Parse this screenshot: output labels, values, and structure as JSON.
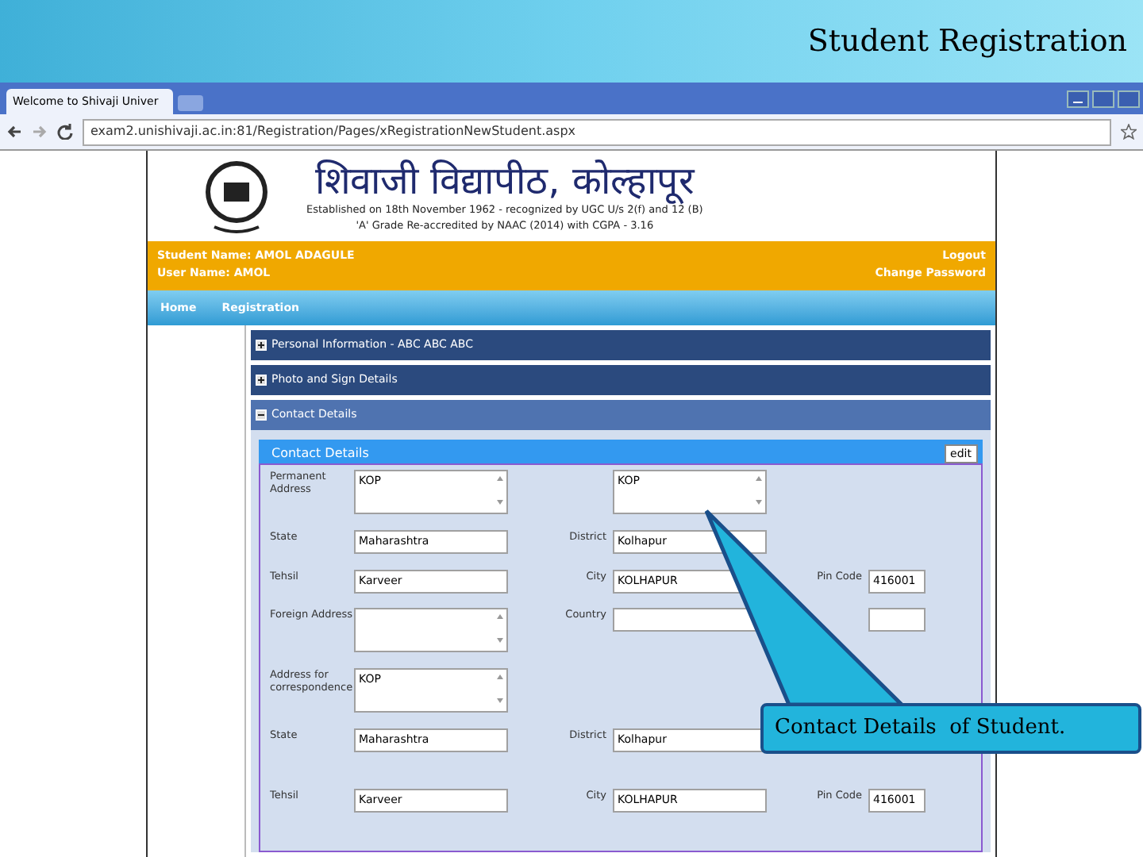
{
  "slide": {
    "title": "Student Registration"
  },
  "browser": {
    "tabs": [
      {
        "label": "Welcome to Shivaji Univer",
        "selected": true
      }
    ],
    "url": "exam2.unishivaji.ac.in:81/Registration/Pages/xRegistrationNewStudent.aspx"
  },
  "site_header": {
    "title": "शिवाजी विद्यापीठ, कोल्हापूर",
    "subtitle": "Established on 18th November 1962 - recognized by UGC U/s 2(f) and 12 (B)",
    "accreditation": "'A' Grade Re-accredited by NAAC (2014) with CGPA - 3.16"
  },
  "user_bar": {
    "student_name": "Student Name: AMOL ADAGULE",
    "user_name": "User Name: AMOL",
    "links": [
      "Logout",
      "Change Password"
    ]
  },
  "nav": [
    "Home",
    "Registration"
  ],
  "sections": [
    {
      "title": "Personal Information - ABC ABC ABC",
      "expanded": false
    },
    {
      "title": "Photo and Sign Details",
      "expanded": false
    },
    {
      "title": "Contact Details",
      "expanded": true
    }
  ],
  "contact_panel": {
    "title": "Contact Details",
    "edit_button": "edit",
    "rows": [
      {
        "fields": [
          {
            "label": "Permanent Address",
            "kind": "textarea",
            "value": "KOP"
          },
          {
            "kind": "textarea",
            "value": "KOP"
          }
        ]
      },
      {
        "fields": [
          {
            "label": "State",
            "kind": "input",
            "value": "Maharashtra"
          },
          {
            "label": "District",
            "kind": "input",
            "value": "Kolhapur"
          }
        ]
      },
      {
        "fields": [
          {
            "label": "Tehsil",
            "kind": "input",
            "value": "Karveer"
          },
          {
            "label": "City",
            "kind": "input",
            "value": "KOLHAPUR"
          },
          {
            "label": "Pin Code",
            "kind": "short",
            "value": "416001"
          }
        ]
      },
      {
        "fields": [
          {
            "label": "Foreign Address",
            "kind": "textarea"
          },
          {
            "label": "Country",
            "kind": "input"
          },
          {
            "kind": "short"
          }
        ]
      },
      {
        "fields": [
          {
            "label": "Address for correspondence",
            "kind": "textarea",
            "value": "KOP"
          }
        ]
      },
      {
        "fields": [
          {
            "label": "State",
            "kind": "input",
            "value": "Maharashtra"
          },
          {
            "label": "District",
            "kind": "input",
            "value": "Kolhapur"
          }
        ]
      },
      {
        "fields": [
          {
            "label": "Tehsil",
            "kind": "input",
            "value": "Karveer"
          },
          {
            "label": "City",
            "kind": "input",
            "value": "KOLHAPUR"
          },
          {
            "label": "Pin Code",
            "kind": "short",
            "value": "416001"
          }
        ]
      }
    ]
  },
  "callout": {
    "text": "Contact Details  of Student."
  }
}
